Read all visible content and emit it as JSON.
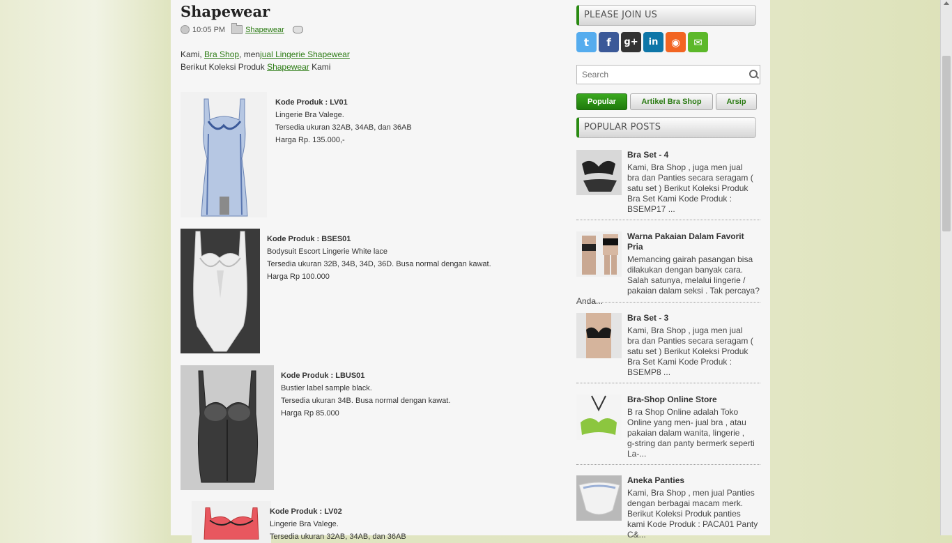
{
  "post": {
    "title": "Shapewear",
    "time": "10:05 PM",
    "category": "Shapewear",
    "intro1_a": "Kami, ",
    "intro1_link1": "Bra Shop",
    "intro1_b": ", men",
    "intro1_link2": "jual Lingerie Shapewear",
    "intro2_a": "Berikut Koleksi Produk ",
    "intro2_link": "Shapewear",
    "intro2_b": " Kami"
  },
  "products": [
    {
      "code": "Kode Produk : LV01",
      "line1": "Lingerie Bra Valege.",
      "line2": "Tersedia ukuran 32AB, 34AB, dan 36AB",
      "line3": "Harga Rp. 135.000,-"
    },
    {
      "code": "Kode Produk : BSES01",
      "line1": "Bodysuit Escort Lingerie White lace",
      "line2": "Tersedia ukuran 32B, 34B, 34D, 36D. Busa normal dengan kawat.",
      "line3": "Harga Rp 100.000"
    },
    {
      "code": "Kode Produk : LBUS01",
      "line1": "Bustier label sample black.",
      "line2": "Tersedia ukuran 34B. Busa normal dengan kawat.",
      "line3": "Harga Rp 85.000"
    },
    {
      "code": "Kode Produk : LV02",
      "line1": "Lingerie Bra Valege.",
      "line2": "Tersedia ukuran 32AB, 34AB, dan 36AB",
      "line3": ""
    }
  ],
  "sidebar": {
    "join_title": "PLEASE JOIN US",
    "social": [
      {
        "name": "twitter-icon",
        "glyph": "t",
        "color": "#55acee"
      },
      {
        "name": "facebook-icon",
        "glyph": "f",
        "color": "#3b5998"
      },
      {
        "name": "googleplus-icon",
        "glyph": "g+",
        "color": "#333333"
      },
      {
        "name": "linkedin-icon",
        "glyph": "in",
        "color": "#0e76a8"
      },
      {
        "name": "rss-icon",
        "glyph": "◉",
        "color": "#f26522"
      },
      {
        "name": "email-icon",
        "glyph": "✉",
        "color": "#5cb82a"
      }
    ],
    "search_placeholder": "Search",
    "tabs": [
      {
        "label": "Popular",
        "active": true
      },
      {
        "label": "Artikel Bra Shop",
        "active": false
      },
      {
        "label": "Arsip",
        "active": false
      }
    ],
    "popular_title": "POPULAR POSTS",
    "posts": [
      {
        "title": "Bra Set - 4",
        "snippet_lines": [
          "Kami, Bra Shop , juga men jual",
          "bra dan Panties secara seragam (",
          "satu set ) Berikut Koleksi Produk",
          "Bra Set Kami Kode Produk :"
        ],
        "tail": "BSEMP17 ..."
      },
      {
        "title": "Warna Pakaian Dalam Favorit Pria",
        "snippet_lines": [
          "Memancing gairah pasangan bisa",
          "dilakukan dengan banyak cara.",
          "Salah satunya, melalui lingerie /"
        ],
        "tail": "pakaian dalam seksi . Tak percaya? Anda..."
      },
      {
        "title": "Bra Set - 3",
        "snippet_lines": [
          "Kami, Bra Shop , juga men jual",
          "bra dan Panties secara seragam (",
          "satu set ) Berikut Koleksi Produk",
          "Bra Set Kami Kode Produk :"
        ],
        "tail": "BSEMP8 ..."
      },
      {
        "title": "Bra-Shop Online Store",
        "snippet_lines": [
          "B ra Shop Online adalah Toko",
          "Online yang men- jual bra , atau",
          "pakaian dalam wanita, lingerie ,",
          "g-string dan panty bermerk seperti"
        ],
        "tail": "La-..."
      },
      {
        "title": "Aneka Panties",
        "snippet_lines": [
          "Kami, Bra Shop , men jual Panties",
          "dengan berbagai macam merk.",
          "Berikut Koleksi Produk panties",
          "kami Kode Produk : PACA01 Panty"
        ],
        "tail": "C&..."
      }
    ]
  }
}
